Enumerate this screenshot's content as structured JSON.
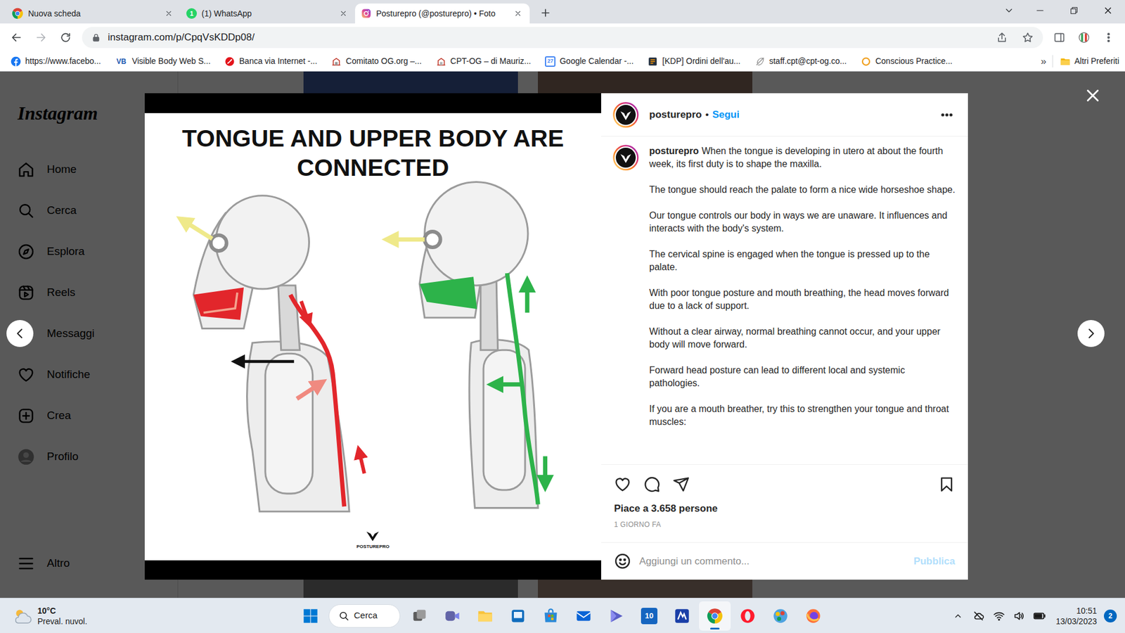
{
  "browser": {
    "tabs": [
      {
        "label": "Nuova scheda",
        "selected": false
      },
      {
        "label": "(1) WhatsApp",
        "selected": false,
        "icon_text": "1"
      },
      {
        "label": "Posturepro (@posturepro) • Foto",
        "selected": true
      }
    ],
    "address": "instagram.com/p/CpqVsKDDp08/",
    "bookmarks": [
      {
        "label": "https://www.facebo..."
      },
      {
        "label": "Visible Body Web S...",
        "icon_text": "VB"
      },
      {
        "label": "Banca via Internet -..."
      },
      {
        "label": "Comitato OG.org –..."
      },
      {
        "label": "CPT-OG – di Mauriz..."
      },
      {
        "label": "Google Calendar -...",
        "icon_text": "27"
      },
      {
        "label": "[KDP] Ordini dell'au..."
      },
      {
        "label": "staff.cpt@cpt-og.co..."
      },
      {
        "label": "Conscious Practice..."
      }
    ],
    "bookmarks_more": "»",
    "other_bookmarks": "Altri Preferiti"
  },
  "instagram": {
    "logo": "Instagram",
    "nav": [
      {
        "label": "Home",
        "selected": false
      },
      {
        "label": "Cerca",
        "selected": false
      },
      {
        "label": "Esplora",
        "selected": false
      },
      {
        "label": "Reels",
        "selected": false
      },
      {
        "label": "Messaggi",
        "selected": false
      },
      {
        "label": "Notifiche",
        "selected": false
      },
      {
        "label": "Crea",
        "selected": false
      },
      {
        "label": "Profilo",
        "selected": false
      }
    ],
    "more": "Altro",
    "post": {
      "image": {
        "title": "TONGUE AND UPPER BODY ARE CONNECTED",
        "brand": "POSTUREPRO"
      },
      "author": "posturepro",
      "separator": "•",
      "follow": "Segui",
      "caption": [
        "When the tongue is developing in utero at about the fourth week, its first duty is to shape the maxilla.",
        "The tongue should reach the palate to form a nice wide horseshoe shape.",
        "Our tongue controls our body in ways we are unaware. It influences and interacts with the body's system.",
        "The cervical spine is engaged when the tongue is pressed up to the palate.",
        "With poor tongue posture and mouth breathing, the head moves forward due to a lack of support.",
        "Without a clear airway, normal breathing cannot occur, and your upper body will move forward.",
        "Forward head posture can lead to different local and systemic pathologies.",
        "If you are a mouth breather, try this to strengthen your tongue and throat muscles:"
      ],
      "liked": false,
      "saved": false,
      "likes": "Piace a 3.658 persone",
      "time": "1 GIORNO FA",
      "comment": {
        "placeholder": "Aggiungi un commento...",
        "submit": "Pubblica",
        "submit_disabled": true
      }
    }
  },
  "taskbar": {
    "weather": {
      "temp": "10°C",
      "desc": "Preval. nuvol."
    },
    "search": "Cerca",
    "apps": [
      {
        "active": false
      },
      {
        "active": false
      },
      {
        "active": false
      },
      {
        "active": false
      },
      {
        "active": false
      },
      {
        "active": false
      },
      {
        "active": false
      },
      {
        "active": false,
        "icon_text": "10"
      },
      {
        "active": false
      },
      {
        "active": true
      },
      {
        "active": false
      },
      {
        "active": false
      },
      {
        "active": false
      }
    ],
    "time": "10:51",
    "date": "13/03/2023",
    "notifications": "2"
  }
}
